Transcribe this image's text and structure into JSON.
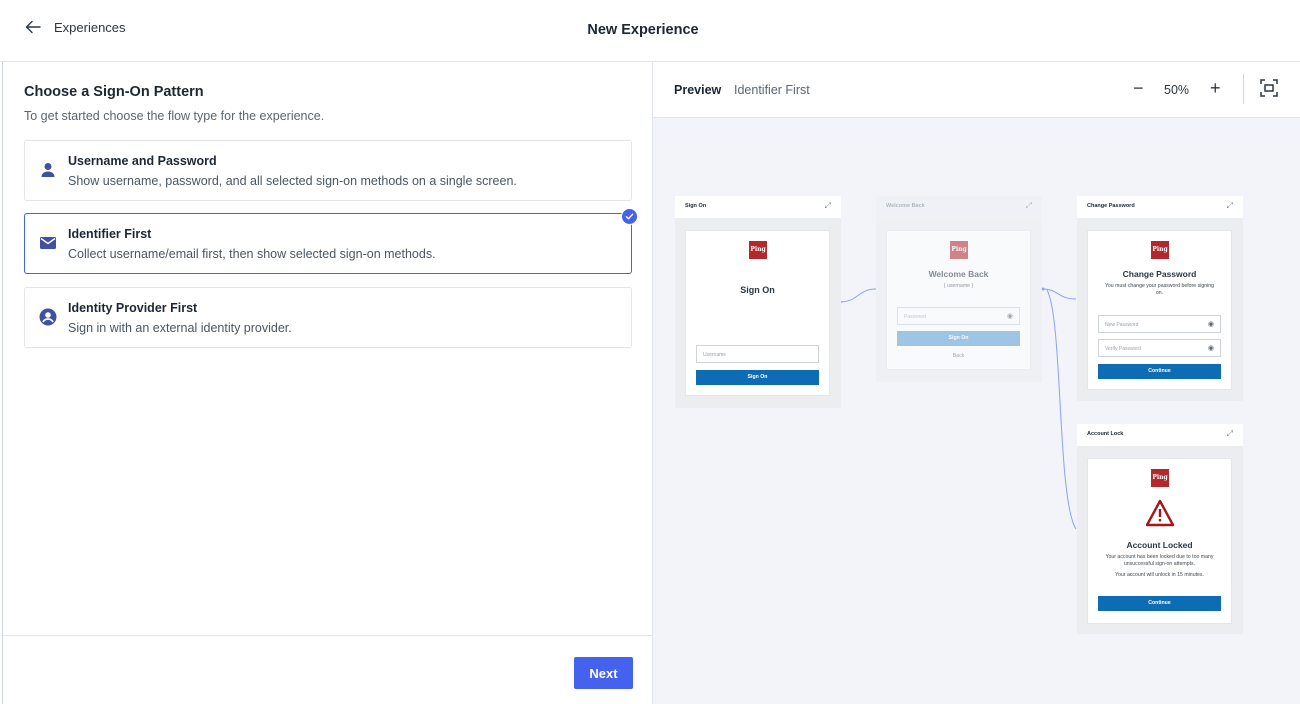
{
  "header": {
    "back_label": "Experiences",
    "title": "New Experience"
  },
  "left": {
    "heading": "Choose a Sign-On Pattern",
    "subheading": "To get started choose the flow type for the experience.",
    "options": [
      {
        "title": "Username and Password",
        "description": "Show username, password, and all selected sign-on methods on a single screen.",
        "icon": "user-icon",
        "selected": false
      },
      {
        "title": "Identifier First",
        "description": "Collect username/email first, then show selected sign-on methods.",
        "icon": "mail-icon",
        "selected": true
      },
      {
        "title": "Identity Provider First",
        "description": "Sign in with an external identity provider.",
        "icon": "account-circle-icon",
        "selected": false
      }
    ],
    "next_label": "Next"
  },
  "preview": {
    "label": "Preview",
    "name": "Identifier First",
    "zoom_out": "−",
    "zoom_level": "50%",
    "zoom_in": "+",
    "frames": {
      "sign_on": {
        "header": "Sign On",
        "logo": "Ping",
        "title": "Sign On",
        "username_placeholder": "Username",
        "button": "Sign On"
      },
      "welcome_back": {
        "header": "Welcome Back",
        "logo": "Ping",
        "title": "Welcome Back",
        "username": "{ username }",
        "password_placeholder": "Password",
        "button": "Sign On",
        "back_link": "Back"
      },
      "change_password": {
        "header": "Change Password",
        "logo": "Ping",
        "title": "Change Password",
        "text": "You must change your password before signing on.",
        "new_password_placeholder": "New Password",
        "verify_password_placeholder": "Verify Password",
        "button": "Continue"
      },
      "account_lock": {
        "header": "Account Lock",
        "logo": "Ping",
        "title": "Account Locked",
        "text1": "Your account has been locked due to too many unsuccessful sign-on attempts.",
        "text2": "Your account will unlock in 15 minutes.",
        "button": "Continue"
      }
    }
  },
  "colors": {
    "accent": "#4462ed",
    "primary_button": "#0e6cb5",
    "brand_logo": "#b3282d",
    "warning": "#a5151a"
  }
}
